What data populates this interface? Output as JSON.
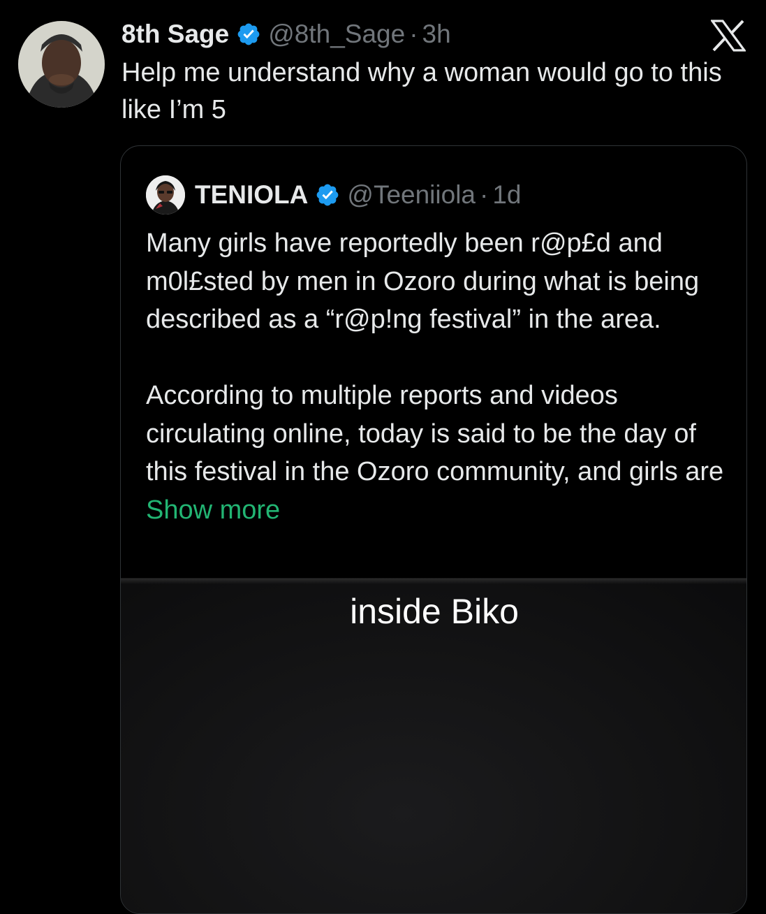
{
  "author": {
    "display_name": "8th Sage",
    "handle": "@8th_Sage",
    "separator": "·",
    "time": "3h"
  },
  "tweet_text": "Help me understand why a woman would go to this like I’m 5",
  "quoted": {
    "display_name": "TENIOLA",
    "handle": "@Teeniiola",
    "separator": "·",
    "time": "1d",
    "paragraph1": "Many girls have reportedly been r@p£d and m0l£sted by men in Ozoro during what is being described as a “r@p!ng festival” in the area.",
    "paragraph2": "According to multiple reports and videos circulating online, today is said to be the day of this festival in the Ozoro community, and girls are ",
    "show_more": "Show more",
    "media_caption": "inside Biko"
  },
  "colors": {
    "verified": "#1d9bf0",
    "show_more": "#22b573",
    "muted": "#71767b"
  },
  "icons": {
    "verified": "verified-badge-icon",
    "brand": "x-logo-icon"
  }
}
